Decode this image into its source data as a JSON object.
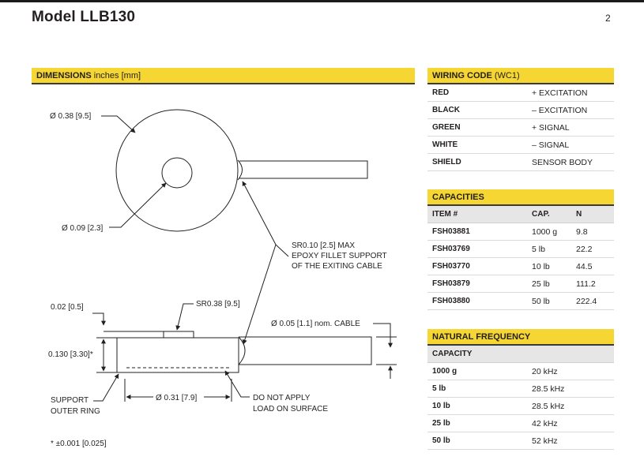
{
  "header": {
    "title": "Model LLB130",
    "page_number": "2"
  },
  "dimensions": {
    "title": "DIMENSIONS",
    "units": "inches [mm]",
    "labels": {
      "outer_dia": "Ø 0.38 [9.5]",
      "hole_dia": "Ø 0.09 [2.3]",
      "fillet_1": "SR0.10 [2.5] MAX",
      "fillet_2": "EPOXY FILLET SUPPORT",
      "fillet_3": "OF THE EXITING CABLE",
      "sr": "SR0.38 [9.5]",
      "button_h": "0.02 [0.5]",
      "body_h": "0.130 [3.30]*",
      "cable": "Ø 0.05 [1.1] nom. CABLE",
      "support_1": "SUPPORT",
      "support_2": "OUTER RING",
      "ring_dia": "Ø 0.31 [7.9]",
      "noload_1": "DO NOT APPLY",
      "noload_2": "LOAD ON SURFACE",
      "footnote": "* ±0.001 [0.025]"
    }
  },
  "wiring": {
    "title": "WIRING CODE",
    "code": "(WC1)",
    "rows": [
      {
        "color": "RED",
        "signal": "+ EXCITATION"
      },
      {
        "color": "BLACK",
        "signal": "– EXCITATION"
      },
      {
        "color": "GREEN",
        "signal": "+ SIGNAL"
      },
      {
        "color": "WHITE",
        "signal": "– SIGNAL"
      },
      {
        "color": "SHIELD",
        "signal": "SENSOR BODY"
      }
    ]
  },
  "capacities": {
    "title": "CAPACITIES",
    "headers": {
      "item": "ITEM #",
      "cap": "CAP.",
      "n": "N"
    },
    "rows": [
      {
        "item": "FSH03881",
        "cap": "1000 g",
        "n": "9.8"
      },
      {
        "item": "FSH03769",
        "cap": "5 lb",
        "n": "22.2"
      },
      {
        "item": "FSH03770",
        "cap": "10 lb",
        "n": "44.5"
      },
      {
        "item": "FSH03879",
        "cap": "25 lb",
        "n": "111.2"
      },
      {
        "item": "FSH03880",
        "cap": "50 lb",
        "n": "222.4"
      }
    ]
  },
  "natural_frequency": {
    "title": "NATURAL FREQUENCY",
    "header": "CAPACITY",
    "rows": [
      {
        "cap": "1000 g",
        "freq": "20 kHz"
      },
      {
        "cap": "5 lb",
        "freq": "28.5 kHz"
      },
      {
        "cap": "10 lb",
        "freq": "28.5 kHz"
      },
      {
        "cap": "25 lb",
        "freq": "42 kHz"
      },
      {
        "cap": "50 lb",
        "freq": "52 kHz"
      }
    ]
  },
  "colors": {
    "accent_bar": "#f5d633",
    "text": "#231f20",
    "table_header": "#e6e6e6"
  }
}
